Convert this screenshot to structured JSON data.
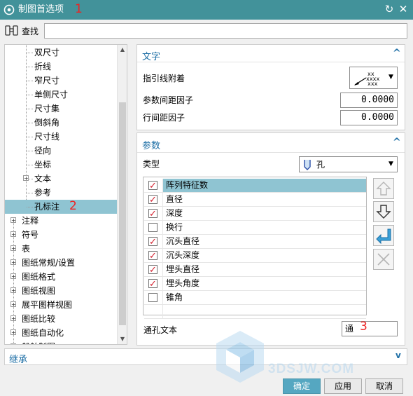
{
  "window": {
    "title": "制图首选项",
    "annotation_1": "1",
    "refresh_icon": "refresh-icon",
    "close_icon": "close-icon"
  },
  "search": {
    "label": "查找",
    "value": ""
  },
  "tree": {
    "children": [
      "双尺寸",
      "折线",
      "窄尺寸",
      "单侧尺寸",
      "尺寸集",
      "倒斜角",
      "尺寸线",
      "径向",
      "坐标",
      "文本",
      "参考",
      "孔标注"
    ],
    "selected": "孔标注",
    "annotation_2": "2",
    "roots": [
      "注释",
      "符号",
      "表",
      "图纸常规/设置",
      "图纸格式",
      "图纸视图",
      "展平图样视图",
      "图纸比较",
      "图纸自动化",
      "船舶制图"
    ]
  },
  "text_panel": {
    "title": "文字",
    "leader_label": "指引线附着",
    "param_spacing_label": "参数间距因子",
    "param_spacing_value": "0.0000",
    "line_spacing_label": "行间距因子",
    "line_spacing_value": "0.0000"
  },
  "params_panel": {
    "title": "参数",
    "type_label": "类型",
    "type_value": "孔",
    "items": [
      {
        "label": "阵列特征数",
        "checked": true
      },
      {
        "label": "直径",
        "checked": true
      },
      {
        "label": "深度",
        "checked": true
      },
      {
        "label": "换行",
        "checked": false
      },
      {
        "label": "沉头直径",
        "checked": true
      },
      {
        "label": "沉头深度",
        "checked": true
      },
      {
        "label": "埋头直径",
        "checked": true
      },
      {
        "label": "埋头角度",
        "checked": true
      },
      {
        "label": "锥角",
        "checked": false
      }
    ],
    "through_text_label": "通孔文本",
    "through_text_value": "通",
    "annotation_3": "3"
  },
  "inherit": {
    "title": "继承"
  },
  "buttons": {
    "ok": "确定",
    "apply": "应用",
    "cancel": "取消"
  },
  "watermark_text": "3DSJW.COM",
  "colors": {
    "titlebar": "#42929a",
    "selection": "#8fc4d2",
    "accent": "#1e6fa6",
    "check": "#d21c2a",
    "annotation": "#e22222"
  }
}
